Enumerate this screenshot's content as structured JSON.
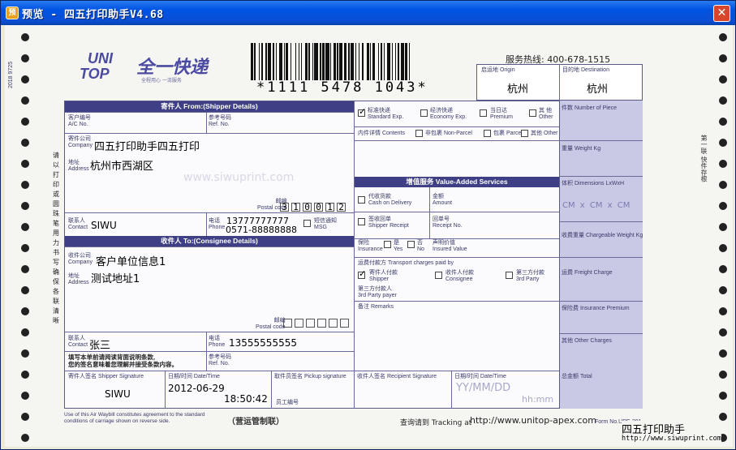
{
  "window": {
    "title": "预览 - 四五打印助手V4.68",
    "icon": "preview-app-icon",
    "close_icon": "close-icon"
  },
  "barcode": {
    "text": "*1111 5478 1043*"
  },
  "company": {
    "logo_top": "UNI",
    "logo_bottom": "TOP",
    "name": "全一快递",
    "slogan": "全程用心 一流服务",
    "hotline": "服务热线: 400-678-1515"
  },
  "side_number": "2018 9725",
  "shipper": {
    "header": "寄件人 From:(Shipper Details)",
    "ac_label": "客户编号\nA/C No.",
    "ref_label": "参考号码\nRef. No.",
    "company_label": "寄件公司\nCompany",
    "company": "四五打印助手四五打印",
    "address_label": "地址\nAddress",
    "address": "杭州市西湖区",
    "postcode_label": "邮编\nPostal code",
    "postcode": [
      "3",
      "1",
      "0",
      "0",
      "1",
      "2"
    ],
    "contact_label": "联系人\nContact",
    "contact": "SIWU",
    "phone_label": "电话\nPhone",
    "phone1": "13777777777",
    "phone2": "0571-88888888",
    "sms_label": "短信通知\nMSG"
  },
  "consignee": {
    "header": "收件人 To:(Consignee Details)",
    "company_label": "收件公司\nCompany",
    "company": "客户单位信息1",
    "address_label": "地址\nAddress",
    "address": "测试地址1",
    "postcode_label": "邮编\nPostal code",
    "contact_label": "联系人\nContact",
    "contact": "张三",
    "phone_label": "电话\nPhone",
    "phone": "13555555555",
    "notice": "填写本单前请阅读背面说明条款,\n您的签名意味着您理解并接受条款内容。",
    "ref_label": "参考号码\nRef. No."
  },
  "signature": {
    "shipper_sig_label": "寄件人签名 Shipper Signature",
    "shipper_sig": "SIWU",
    "date_label": "日期/时间 Date/Time",
    "date": "2012-06-29",
    "time": "18:50:42",
    "pickup_label": "取件员签名 Pickup signature",
    "staff_label": "员工编号",
    "recipient_label": "收件人签名 Recipient Signature",
    "recv_date_label": "日期/时间 Date/Time",
    "yymmdd": "YY/MM/DD",
    "hhmm": "hh:mm"
  },
  "origin": {
    "label": "启运地 Origin",
    "value": "杭州"
  },
  "destination": {
    "label": "目的地 Destination",
    "value": "杭州"
  },
  "service": {
    "standard": "标准快递\nStandard Exp.",
    "economy": "经济快递\nEconomy Exp.",
    "premium": "当日达\nPremium",
    "other": "其 他\nOther",
    "contents_label": "内件详情 Contents",
    "non_parcel": "非包裹 Non-Parcel",
    "parcel": "包裹 Parcel",
    "other2": "其他 Other"
  },
  "value_added": {
    "header": "增值服务 Value-Added Services",
    "cod": "代收货款\nCash on Delivery",
    "amount": "金额\nAmount",
    "receipt": "签收回单\nShipper Receipt",
    "receipt_no": "回单号\nReceipt No.",
    "insurance": "保险\nInsurance",
    "yes": "是\nYes",
    "no": "否\nNo",
    "insured_value": "声明价值\nInsured Value",
    "transport_label": "运费付款方 Transport charges paid by",
    "pay_shipper": "寄件人付款\nShipper",
    "pay_consignee": "收件人付款\nConsignee",
    "pay_third": "第三方付款\n3rd Party",
    "third_party_label": "第三方付款人\n3rd Party payer",
    "remarks_label": "备注 Remarks"
  },
  "charges": {
    "pieces": "件数 Number of Piece",
    "weight": "重量 Weight Kg",
    "dimensions": "体积 Dimensions LxWxH",
    "dim_value": "CM x CM x CM",
    "chargeable": "收费重量 Chargeable Weight Kg",
    "freight": "运费 Freight Charge",
    "insurance_premium": "保险费 Insurance Premium",
    "other_charges": "其他 Other Charges",
    "total": "总金额 Total"
  },
  "footer": {
    "terms": "Use of this Air Waybill constitutes agreement to the standard\nconditions of carriage shown on reverse side.",
    "permit": "（营运管制联）",
    "tracking_label": "查询请到 Tracking at",
    "tracking_url": "http://www.unitop-apex.com",
    "form_no": "Form No.UPE-201",
    "watermark_title": "四五打印助手",
    "watermark_url": "http://www.siwuprint.com",
    "watermark_domain": "www.siwuprint.com"
  },
  "side_text": [
    "请",
    "以",
    "打",
    "印",
    "或",
    "圆",
    "珠",
    "笔",
    "用",
    "力",
    "书",
    "写",
    "确",
    "保",
    "各",
    "联",
    "清",
    "晰"
  ],
  "right_side_text": "第一联 快件存根"
}
